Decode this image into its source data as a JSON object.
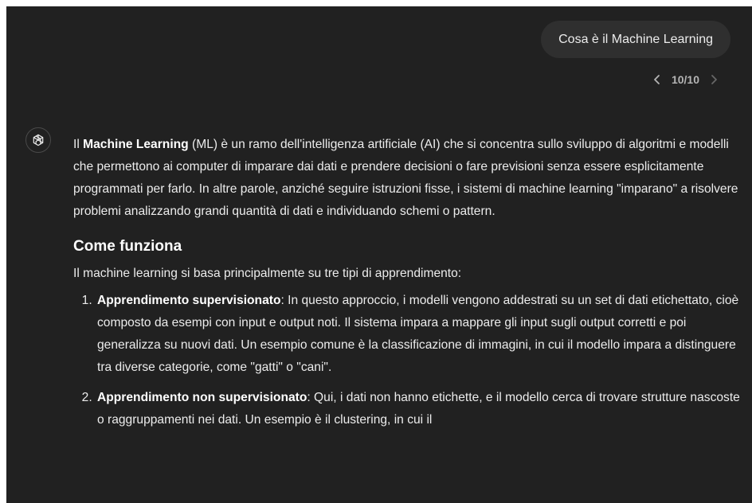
{
  "user_message": "Cosa è il Machine Learning",
  "pager": {
    "prev": "‹",
    "count": "10/10",
    "next": "›"
  },
  "assistant": {
    "intro": {
      "prefix": "Il ",
      "term": "Machine Learning",
      "rest": " (ML) è un ramo dell'intelligenza artificiale (AI) che si concentra sullo sviluppo di algoritmi e modelli che permettono ai computer di imparare dai dati e prendere decisioni o fare previsioni senza essere esplicitamente programmati per farlo. In altre parole, anziché seguire istruzioni fisse, i sistemi di machine learning \"imparano\" a risolvere problemi analizzando grandi quantità di dati e individuando schemi o pattern."
    },
    "heading": "Come funziona",
    "lead": "Il machine learning si basa principalmente su tre tipi di apprendimento:",
    "items": [
      {
        "title": "Apprendimento supervisionato",
        "text": ": In questo approccio, i modelli vengono addestrati su un set di dati etichettato, cioè composto da esempi con input e output noti. Il sistema impara a mappare gli input sugli output corretti e poi generalizza su nuovi dati. Un esempio comune è la classificazione di immagini, in cui il modello impara a distinguere tra diverse categorie, come \"gatti\" o \"cani\"."
      },
      {
        "title": "Apprendimento non supervisionato",
        "text": ": Qui, i dati non hanno etichette, e il modello cerca di trovare strutture nascoste o raggruppamenti nei dati. Un esempio è il clustering, in cui il"
      }
    ]
  }
}
